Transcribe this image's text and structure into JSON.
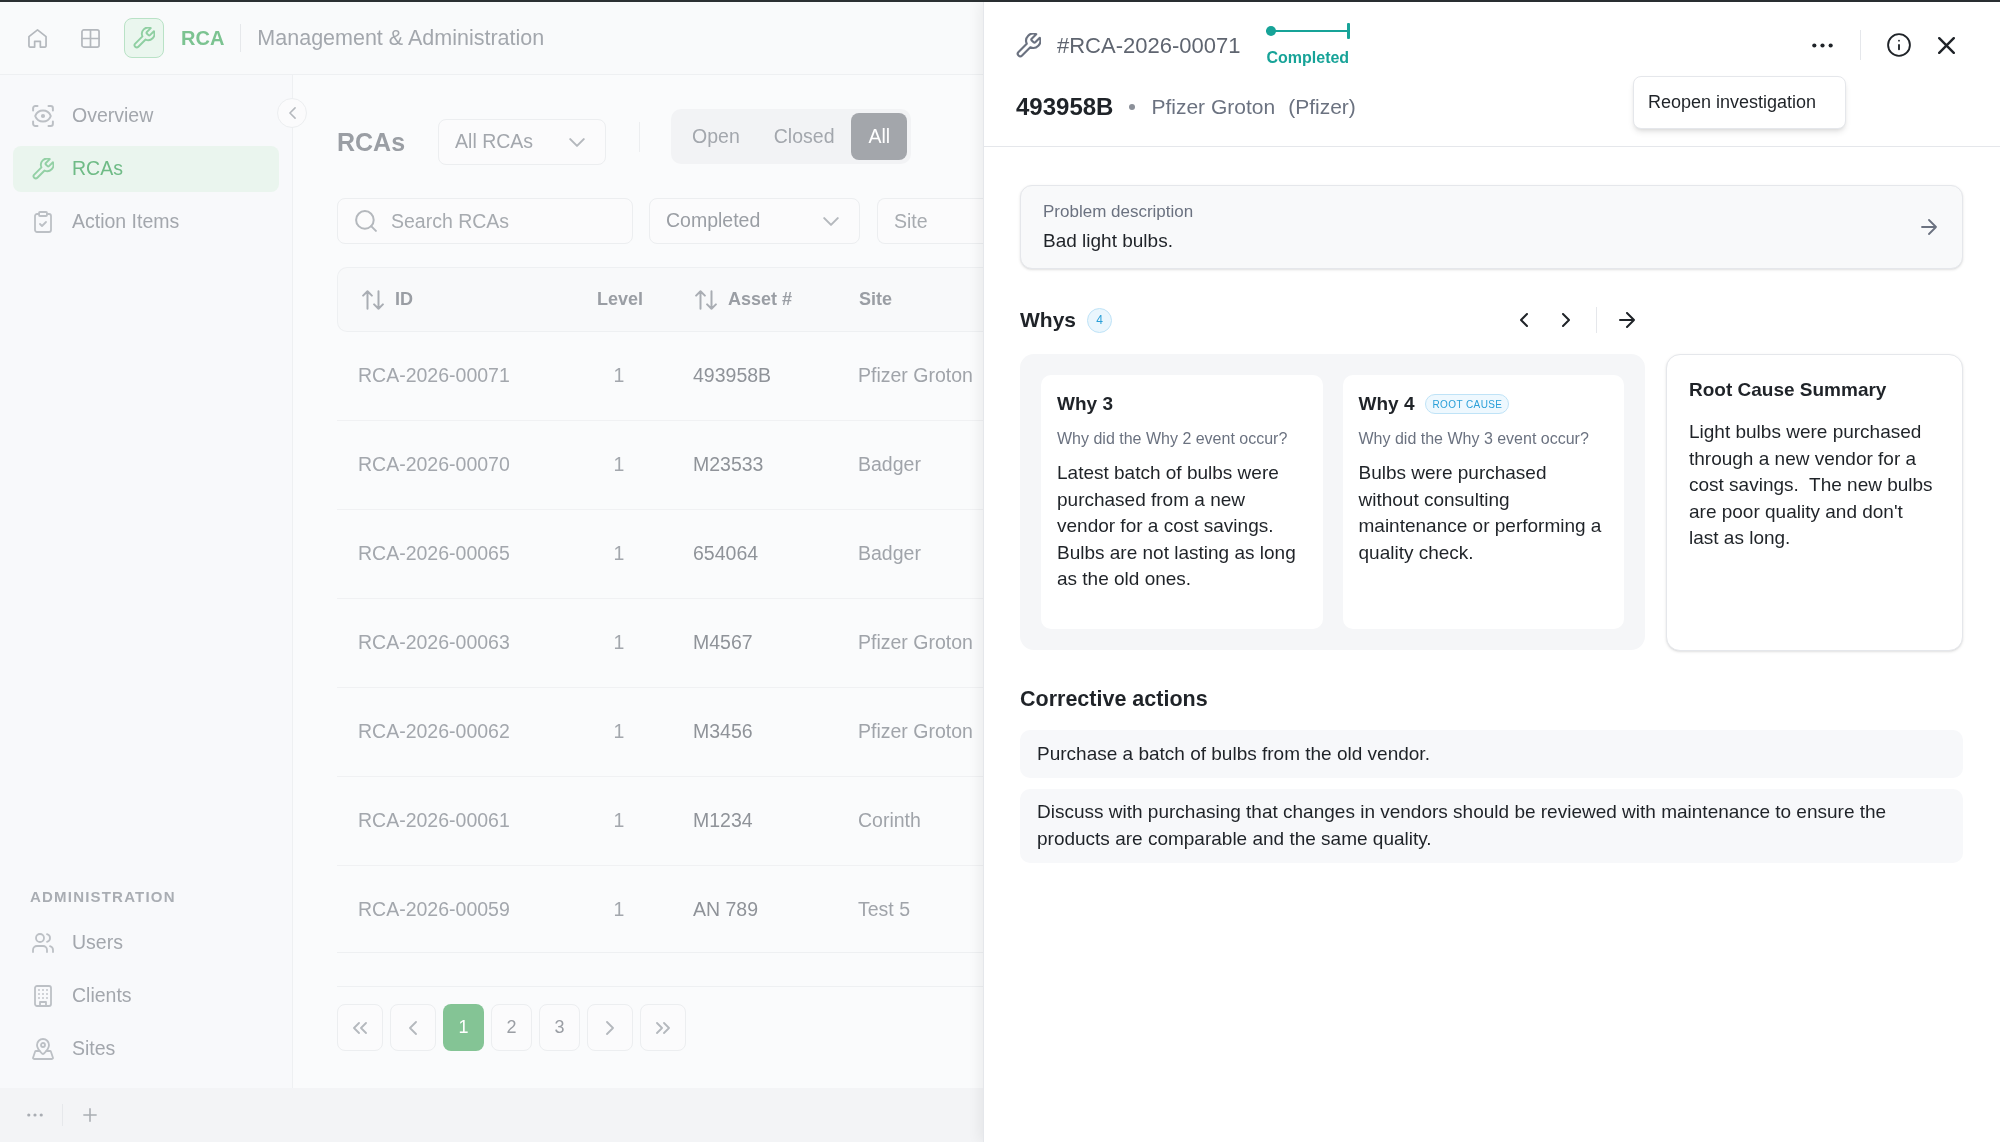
{
  "app_header": {
    "app_name": "RCA",
    "title": "Management & Administration"
  },
  "sidebar": {
    "items": [
      {
        "label": "Overview",
        "selected": false
      },
      {
        "label": "RCAs",
        "selected": true
      },
      {
        "label": "Action Items",
        "selected": false
      }
    ],
    "admin_title": "ADMINISTRATION",
    "admin_items": [
      {
        "label": "Users",
        "selected": false
      },
      {
        "label": "Clients",
        "selected": false
      },
      {
        "label": "Sites",
        "selected": false
      }
    ]
  },
  "list_page": {
    "title": "RCAs",
    "scope_select": {
      "value": "All RCAs"
    },
    "status_tabs": [
      {
        "label": "Open",
        "selected": false
      },
      {
        "label": "Closed",
        "selected": false
      },
      {
        "label": "All",
        "selected": true
      }
    ],
    "search": {
      "placeholder": "Search RCAs"
    },
    "status_select": {
      "value": "Completed"
    },
    "site_filter": {
      "placeholder": "Site"
    }
  },
  "table": {
    "columns": [
      {
        "label": "ID",
        "sortable": true
      },
      {
        "label": "Level",
        "sortable": false
      },
      {
        "label": "Asset #",
        "sortable": true
      },
      {
        "label": "Site",
        "sortable": false
      }
    ],
    "rows": [
      [
        "RCA-2026-00071",
        "1",
        "493958B",
        "Pfizer Groton"
      ],
      [
        "RCA-2026-00070",
        "1",
        "M23533",
        "Badger"
      ],
      [
        "RCA-2026-00065",
        "1",
        "654064",
        "Badger"
      ],
      [
        "RCA-2026-00063",
        "1",
        "M4567",
        "Pfizer Groton"
      ],
      [
        "RCA-2026-00062",
        "1",
        "M3456",
        "Pfizer Groton"
      ],
      [
        "RCA-2026-00061",
        "1",
        "M1234",
        "Corinth"
      ],
      [
        "RCA-2026-00059",
        "1",
        "AN 789",
        "Test 5"
      ]
    ]
  },
  "pagination": {
    "pages": [
      {
        "label": "1",
        "selected": true
      },
      {
        "label": "2",
        "selected": false
      },
      {
        "label": "3",
        "selected": false
      }
    ]
  },
  "detail_panel": {
    "record_id": "#RCA-2026-00071",
    "status": {
      "label": "Completed",
      "level": 1
    },
    "asset": "493958B",
    "site": "Pfizer Groton",
    "client": "(Pfizer)",
    "menu": {
      "items": [
        "Reopen investigation"
      ]
    },
    "problem": {
      "label": "Problem description",
      "text": "Bad light bulbs."
    },
    "whys": {
      "title": "Whys",
      "count": "4",
      "items": [
        {
          "title": "Why 3",
          "question": "Why did the Why 2 event occur?",
          "answer": "Latest batch of bulbs were purchased from a new vendor for a cost savings. Bulbs are not lasting as long as the old ones."
        },
        {
          "title": "Why 4",
          "badge": "ROOT CAUSE",
          "question": "Why did the Why 3 event occur?",
          "answer": "Bulbs were purchased without consulting maintenance or performing a quality check."
        }
      ]
    },
    "root_cause_summary": {
      "title": "Root Cause Summary",
      "text": "Light bulbs were purchased through a new vendor for a cost savings.  The new bulbs are poor quality and don't last as long."
    },
    "corrective_actions": {
      "title": "Corrective actions",
      "items": [
        "Purchase a batch of bulbs from the old vendor.",
        "Discuss with purchasing that changes in vendors should be reviewed with maintenance to ensure the products are comparable and the same quality."
      ]
    }
  }
}
